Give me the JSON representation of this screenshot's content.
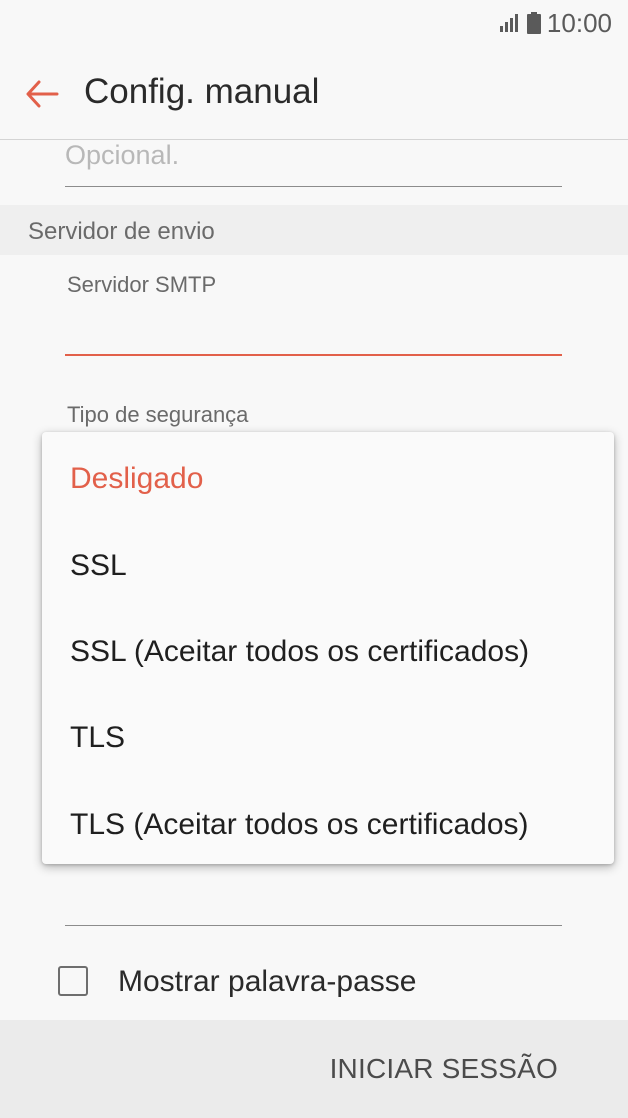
{
  "status_bar": {
    "time": "10:00"
  },
  "app_bar": {
    "title": "Config. manual"
  },
  "form": {
    "optional_hint": "Opcional.",
    "section_title": "Servidor de envio",
    "smtp_label": "Servidor SMTP",
    "smtp_value": "",
    "security_label": "Tipo de segurança",
    "show_password_label": "Mostrar palavra-passe",
    "show_password_checked": false
  },
  "security_dropdown": {
    "selected": "Desligado",
    "options": [
      "Desligado",
      "SSL",
      "SSL (Aceitar todos os certificados)",
      "TLS",
      "TLS (Aceitar todos os certificados)"
    ]
  },
  "bottom_bar": {
    "sign_in_label": "INICIAR SESSÃO"
  },
  "colors": {
    "accent": "#e2604a",
    "background": "#f8f8f8",
    "section_background": "#efefef",
    "bottom_bar_background": "#ebebeb"
  }
}
